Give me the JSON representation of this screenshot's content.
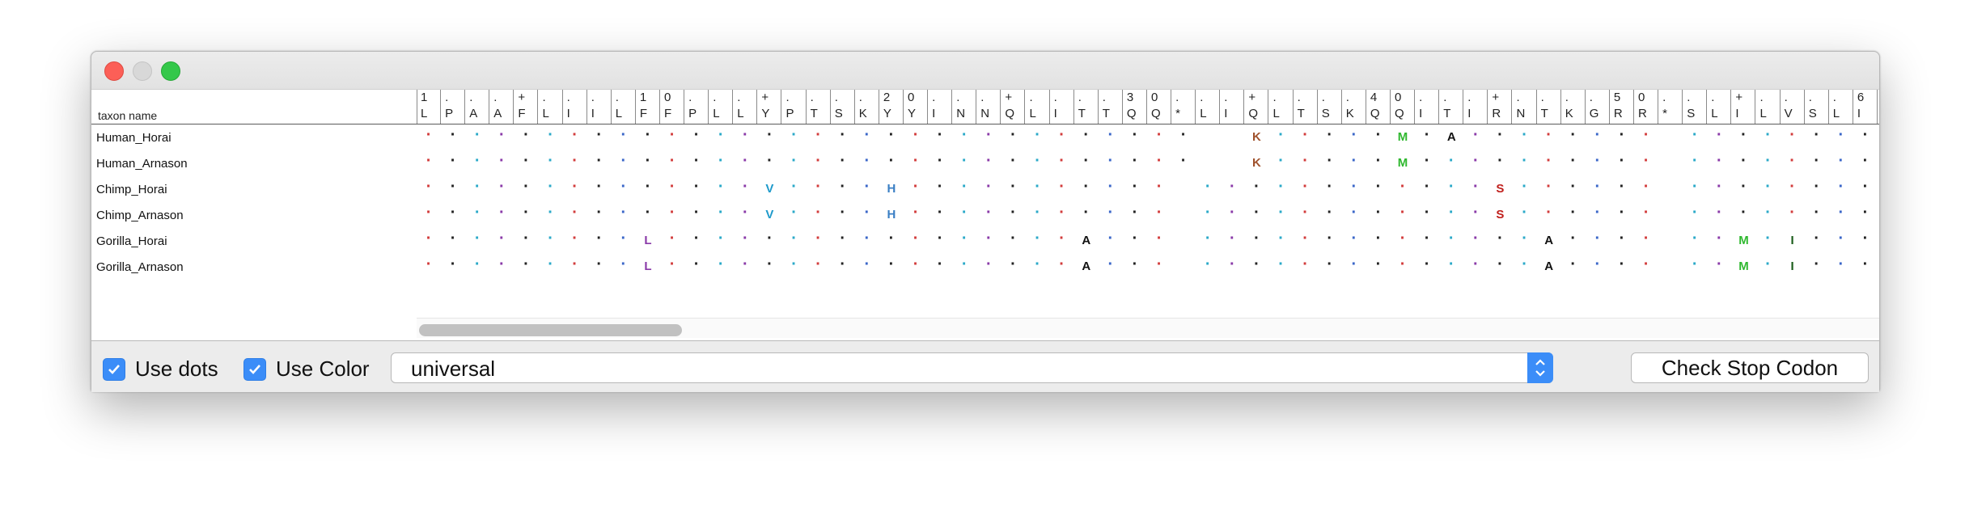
{
  "window": {
    "buttons": [
      "close",
      "minimize",
      "zoom"
    ]
  },
  "table": {
    "name_header": "taxon name",
    "header_columns": [
      {
        "top": "1",
        "bottom": "L"
      },
      {
        "top": ".",
        "bottom": "P"
      },
      {
        "top": ".",
        "bottom": "A"
      },
      {
        "top": ".",
        "bottom": "A"
      },
      {
        "top": "+",
        "bottom": "F"
      },
      {
        "top": ".",
        "bottom": "L"
      },
      {
        "top": ".",
        "bottom": "I"
      },
      {
        "top": ".",
        "bottom": "I"
      },
      {
        "top": ".",
        "bottom": "L"
      },
      {
        "top": "1",
        "bottom": "F"
      },
      {
        "top": "0",
        "bottom": "F"
      },
      {
        "top": ".",
        "bottom": "P"
      },
      {
        "top": ".",
        "bottom": "L"
      },
      {
        "top": ".",
        "bottom": "L"
      },
      {
        "top": "+",
        "bottom": "Y"
      },
      {
        "top": ".",
        "bottom": "P"
      },
      {
        "top": ".",
        "bottom": "T"
      },
      {
        "top": ".",
        "bottom": "S"
      },
      {
        "top": ".",
        "bottom": "K"
      },
      {
        "top": "2",
        "bottom": "Y"
      },
      {
        "top": "0",
        "bottom": "Y"
      },
      {
        "top": ".",
        "bottom": "I"
      },
      {
        "top": ".",
        "bottom": "N"
      },
      {
        "top": ".",
        "bottom": "N"
      },
      {
        "top": "+",
        "bottom": "Q"
      },
      {
        "top": ".",
        "bottom": "L"
      },
      {
        "top": ".",
        "bottom": "I"
      },
      {
        "top": ".",
        "bottom": "T"
      },
      {
        "top": ".",
        "bottom": "T"
      },
      {
        "top": "3",
        "bottom": "Q"
      },
      {
        "top": "0",
        "bottom": "Q"
      },
      {
        "top": ".",
        "bottom": "*"
      },
      {
        "top": ".",
        "bottom": "L"
      },
      {
        "top": ".",
        "bottom": "I"
      },
      {
        "top": "+",
        "bottom": "Q"
      },
      {
        "top": ".",
        "bottom": "L"
      },
      {
        "top": ".",
        "bottom": "T"
      },
      {
        "top": ".",
        "bottom": "S"
      },
      {
        "top": ".",
        "bottom": "K"
      },
      {
        "top": "4",
        "bottom": "Q"
      },
      {
        "top": "0",
        "bottom": "Q"
      },
      {
        "top": ".",
        "bottom": "I"
      },
      {
        "top": ".",
        "bottom": "T"
      },
      {
        "top": ".",
        "bottom": "I"
      },
      {
        "top": "+",
        "bottom": "R"
      },
      {
        "top": ".",
        "bottom": "N"
      },
      {
        "top": ".",
        "bottom": "T"
      },
      {
        "top": ".",
        "bottom": "K"
      },
      {
        "top": ".",
        "bottom": "G"
      },
      {
        "top": "5",
        "bottom": "R"
      },
      {
        "top": "0",
        "bottom": "R"
      },
      {
        "top": ".",
        "bottom": "*"
      },
      {
        "top": ".",
        "bottom": "S"
      },
      {
        "top": ".",
        "bottom": "L"
      },
      {
        "top": "+",
        "bottom": "I"
      },
      {
        "top": ".",
        "bottom": "L"
      },
      {
        "top": ".",
        "bottom": "V"
      },
      {
        "top": ".",
        "bottom": "S"
      },
      {
        "top": ".",
        "bottom": "L"
      },
      {
        "top": "6",
        "bottom": "I"
      }
    ],
    "rows": [
      {
        "name": "Human_Horai",
        "diffs": {
          "34": "K",
          "40": "M",
          "42": "A"
        },
        "blanks": [
          32,
          33,
          51
        ]
      },
      {
        "name": "Human_Arnason",
        "diffs": {
          "34": "K",
          "40": "M"
        },
        "blanks": [
          32,
          33,
          51
        ]
      },
      {
        "name": "Chimp_Horai",
        "diffs": {
          "14": "V",
          "19": "H",
          "44": "S"
        },
        "blanks": [
          31,
          51
        ]
      },
      {
        "name": "Chimp_Arnason",
        "diffs": {
          "14": "V",
          "19": "H",
          "44": "S"
        },
        "blanks": [
          31,
          51
        ]
      },
      {
        "name": "Gorilla_Horai",
        "diffs": {
          "9": "L",
          "27": "A",
          "46": "A",
          "54": "M",
          "56": "I"
        },
        "blanks": [
          31,
          51
        ]
      },
      {
        "name": "Gorilla_Arnason",
        "diffs": {
          "9": "L",
          "27": "A",
          "46": "A",
          "54": "M",
          "56": "I"
        },
        "blanks": [
          31,
          51
        ]
      }
    ]
  },
  "colors": {
    "K": "#a0522d",
    "M": "#2fb82f",
    "A": "#111111",
    "V": "#1e9acb",
    "H": "#3a7fc4",
    "S": "#c0201d",
    "L": "#8a3aa8",
    "I": "#1a5c1a",
    "dot_palette": [
      "#d23b3b",
      "#222222",
      "#2aa9c8",
      "#8a3aa8",
      "#222222",
      "#2aa9c8",
      "#d23b3b",
      "#222222",
      "#3a66c8",
      "#222222"
    ]
  },
  "controls": {
    "use_dots_label": "Use dots",
    "use_color_label": "Use Color",
    "genetic_code_selected": "universal",
    "check_stop_codon_label": "Check Stop Codon"
  }
}
